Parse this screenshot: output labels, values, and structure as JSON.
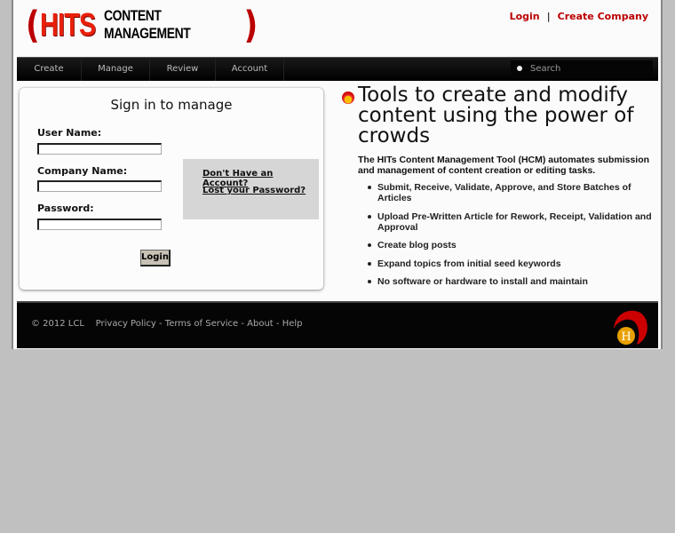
{
  "logo": {
    "bracket_left": "(",
    "hits": "HITS",
    "content_management": "CONTENT MANAGEMENT",
    "bracket_right": ")"
  },
  "header": {
    "login": "Login",
    "separator": "|",
    "create_company": "Create Company"
  },
  "nav": {
    "items": [
      "Create",
      "Manage",
      "Review",
      "Account"
    ],
    "search_placeholder": "Search"
  },
  "signin": {
    "title": "Sign in to manage",
    "user_label": "User Name:",
    "company_label": "Company Name:",
    "password_label": "Password:",
    "user_value": "",
    "company_value": "",
    "password_value": "",
    "login_button": "Login",
    "no_account": "Don't Have an Account?",
    "lost_password": "Lost your Password?"
  },
  "main": {
    "title": "Tools to create and modify content using the power of crowds",
    "intro": "The HITs Content Management Tool (HCM) automates submission and management of content creation or editing tasks.",
    "features": [
      "Submit, Receive, Validate, Approve, and Store Batches of Articles",
      "Upload Pre-Written Article for Rework, Receipt, Validation and Approval",
      "Create blog posts",
      "Expand topics from initial seed keywords",
      "No software or hardware to install and maintain"
    ]
  },
  "footer": {
    "copyright": "© 2012 LCL",
    "privacy": "Privacy Policy",
    "terms": "Terms of Service",
    "about": "About",
    "help": "Help",
    "dash": " - ",
    "logo_letter": "H"
  },
  "colors": {
    "brand_red": "#bb0000",
    "nav_bg": "#000000",
    "background": "#c0c0c0"
  }
}
